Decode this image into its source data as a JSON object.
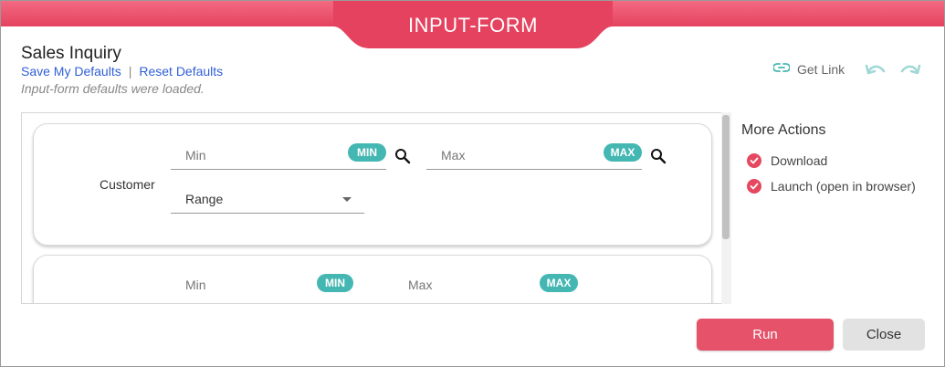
{
  "header": {
    "tab_title": "INPUT-FORM"
  },
  "form": {
    "title": "Sales Inquiry",
    "save_defaults": "Save My Defaults",
    "separator": "|",
    "reset_defaults": "Reset Defaults",
    "status_note": "Input-form defaults were loaded.",
    "get_link": "Get Link"
  },
  "fields": [
    {
      "label": "Customer",
      "min_placeholder": "Min",
      "min_badge": "MIN",
      "max_placeholder": "Max",
      "max_badge": "MAX",
      "mode": "Range"
    },
    {
      "label": "",
      "min_placeholder": "Min",
      "min_badge": "MIN",
      "max_placeholder": "Max",
      "max_badge": "MAX"
    }
  ],
  "more_actions": {
    "title": "More Actions",
    "items": [
      "Download",
      "Launch (open in browser)"
    ]
  },
  "buttons": {
    "run": "Run",
    "close": "Close"
  },
  "colors": {
    "accent": "#e5485f",
    "badge": "#45b7b3",
    "link": "#2f5fd6"
  },
  "icons": [
    "link-icon",
    "undo-icon",
    "redo-icon",
    "search-icon",
    "check-icon",
    "caret-down-icon"
  ]
}
